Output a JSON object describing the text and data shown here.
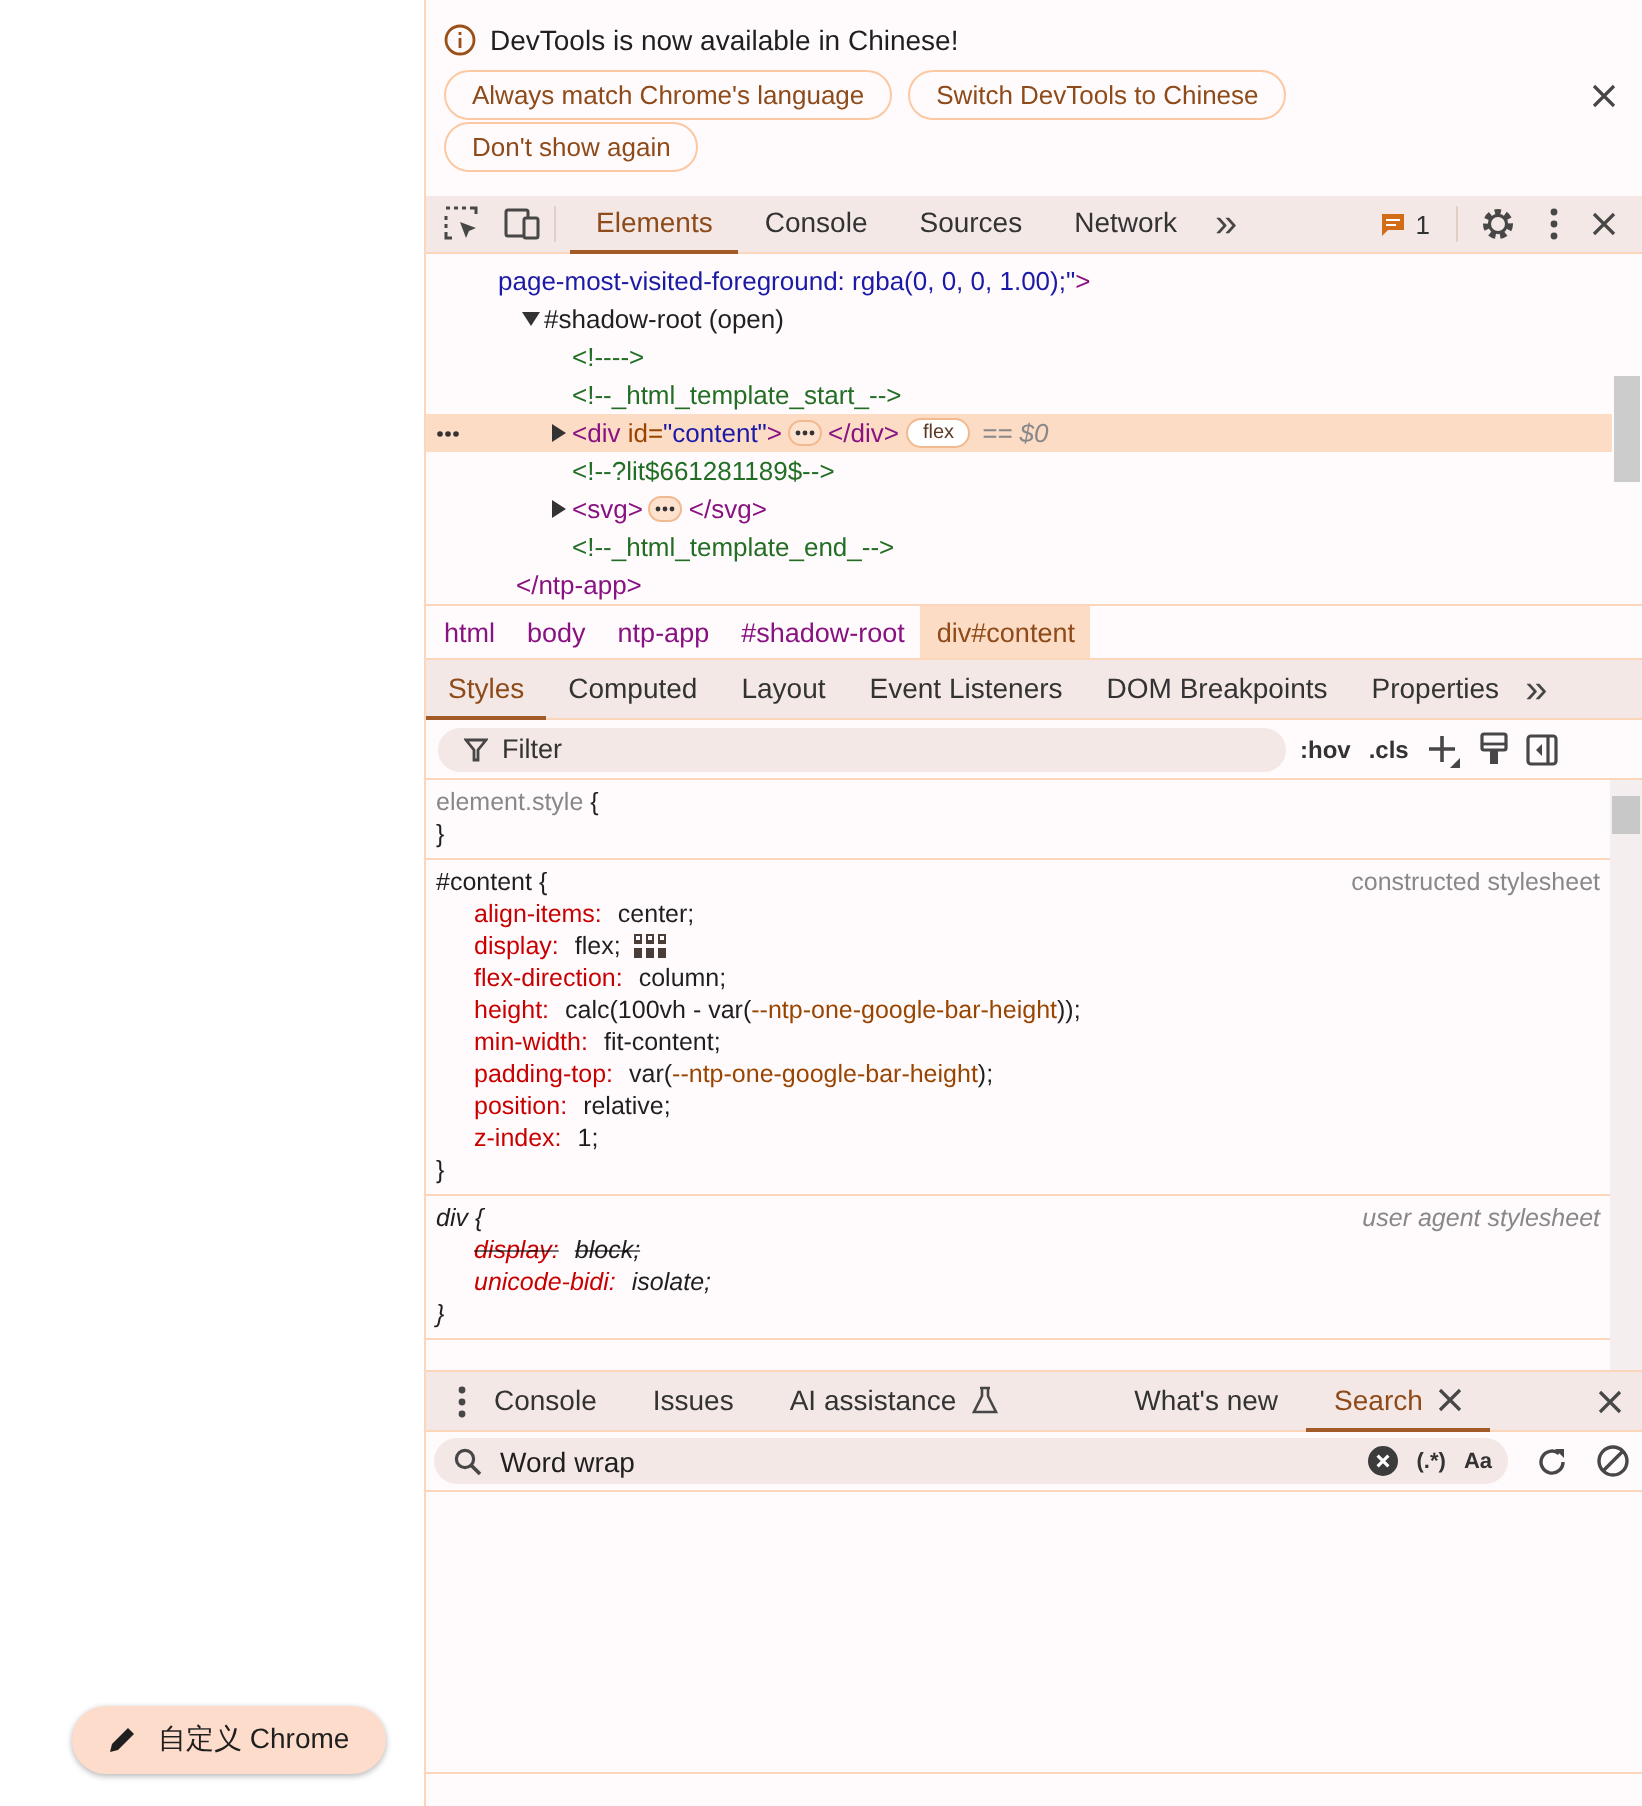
{
  "page": {
    "customize_button": "自定义 Chrome"
  },
  "infobar": {
    "message": "DevTools is now available in Chinese!",
    "buttons": [
      "Always match Chrome's language",
      "Switch DevTools to Chinese",
      "Don't show again"
    ]
  },
  "main_toolbar": {
    "tabs": [
      {
        "label": "Elements",
        "selected": true
      },
      {
        "label": "Console",
        "selected": false
      },
      {
        "label": "Sources",
        "selected": false
      },
      {
        "label": "Network",
        "selected": false
      }
    ],
    "overflow": "»",
    "issues_count": "1"
  },
  "dom_tree": {
    "nodes": [
      {
        "kind": "element-tail",
        "tail": [
          {
            "text": "page-most-visited-foreground: rgba(0, 0, 0, 1.00);\"",
            "kind": "attr-value"
          },
          {
            "text": ">",
            "kind": "tag"
          }
        ],
        "close": [
          {
            "text": "</ntp-app>",
            "kind": "tag"
          }
        ],
        "children": [
          {
            "kind": "shadow-root",
            "label": "#shadow-root (open)",
            "expanded": true,
            "children": [
              {
                "kind": "comment",
                "text": "<!---->"
              },
              {
                "kind": "comment",
                "text": "<!--_html_template_start_-->"
              },
              {
                "kind": "element",
                "open": [
                  {
                    "text": "<div ",
                    "kind": "tag"
                  },
                  {
                    "text": "id=",
                    "kind": "attr-name"
                  },
                  {
                    "text": "\"content\"",
                    "kind": "attr-value"
                  },
                  {
                    "text": ">",
                    "kind": "tag"
                  }
                ],
                "close": [
                  {
                    "text": "</div>",
                    "kind": "tag"
                  }
                ],
                "badge": "flex",
                "hint": "== $0",
                "expanded": false,
                "selected": true
              },
              {
                "kind": "comment",
                "text": "<!--?lit$661281189$-->"
              },
              {
                "kind": "element",
                "open": [
                  {
                    "text": "<svg>",
                    "kind": "tag"
                  }
                ],
                "close": [
                  {
                    "text": "</svg>",
                    "kind": "tag"
                  }
                ],
                "expanded": false,
                "selected": false
              },
              {
                "kind": "comment",
                "text": "<!--_html_template_end_-->"
              }
            ]
          }
        ]
      }
    ]
  },
  "breadcrumbs": [
    {
      "label": "html",
      "selected": false
    },
    {
      "label": "body",
      "selected": false
    },
    {
      "label": "ntp-app",
      "selected": false
    },
    {
      "label": "#shadow-root",
      "selected": false
    },
    {
      "label": "div#content",
      "selected": true
    }
  ],
  "styles": {
    "tabs": [
      {
        "label": "Styles",
        "selected": true
      },
      {
        "label": "Computed",
        "selected": false
      },
      {
        "label": "Layout",
        "selected": false
      },
      {
        "label": "Event Listeners",
        "selected": false
      },
      {
        "label": "DOM Breakpoints",
        "selected": false
      },
      {
        "label": "Properties",
        "selected": false
      }
    ],
    "overflow": "»",
    "filter": {
      "placeholder": "Filter"
    },
    "hov": ":hov",
    "cls": ".cls",
    "rules": [
      {
        "kind": "inline",
        "selector": "element.style",
        "open_brace": "{",
        "close_brace": "}"
      },
      {
        "kind": "author",
        "selector": "#content",
        "open_brace": "{",
        "close_brace": "}",
        "source": "constructed stylesheet",
        "declarations": [
          {
            "name": "align-items:",
            "value": [
              {
                "text": "center;",
                "kind": "plain"
              }
            ],
            "overridden": false,
            "flex_editor": false
          },
          {
            "name": "display:",
            "value": [
              {
                "text": "flex;",
                "kind": "plain"
              }
            ],
            "overridden": false,
            "flex_editor": true
          },
          {
            "name": "flex-direction:",
            "value": [
              {
                "text": "column;",
                "kind": "plain"
              }
            ],
            "overridden": false,
            "flex_editor": false
          },
          {
            "name": "height:",
            "value": [
              {
                "text": "calc(100vh - var(",
                "kind": "plain"
              },
              {
                "text": "--ntp-one-google-bar-height",
                "kind": "var"
              },
              {
                "text": "));",
                "kind": "plain"
              }
            ],
            "overridden": false,
            "flex_editor": false
          },
          {
            "name": "min-width:",
            "value": [
              {
                "text": "fit-content;",
                "kind": "plain"
              }
            ],
            "overridden": false,
            "flex_editor": false
          },
          {
            "name": "padding-top:",
            "value": [
              {
                "text": "var(",
                "kind": "plain"
              },
              {
                "text": "--ntp-one-google-bar-height",
                "kind": "var"
              },
              {
                "text": ");",
                "kind": "plain"
              }
            ],
            "overridden": false,
            "flex_editor": false
          },
          {
            "name": "position:",
            "value": [
              {
                "text": "relative;",
                "kind": "plain"
              }
            ],
            "overridden": false,
            "flex_editor": false
          },
          {
            "name": "z-index:",
            "value": [
              {
                "text": "1;",
                "kind": "plain"
              }
            ],
            "overridden": false,
            "flex_editor": false
          }
        ]
      },
      {
        "kind": "user-agent",
        "selector": "div",
        "open_brace": "{",
        "close_brace": "}",
        "source": "user agent stylesheet",
        "declarations": [
          {
            "name": "display:",
            "value": [
              {
                "text": "block;",
                "kind": "plain"
              }
            ],
            "overridden": true,
            "flex_editor": false
          },
          {
            "name": "unicode-bidi:",
            "value": [
              {
                "text": "isolate;",
                "kind": "plain"
              }
            ],
            "overridden": false,
            "flex_editor": false
          }
        ]
      }
    ]
  },
  "drawer": {
    "tabs": [
      {
        "label": "Console",
        "selected": false,
        "closable": false,
        "experimental": false
      },
      {
        "label": "Issues",
        "selected": false,
        "closable": false,
        "experimental": false
      },
      {
        "label": "AI assistance",
        "selected": false,
        "closable": false,
        "experimental": true
      },
      {
        "label": "What's new",
        "selected": false,
        "closable": false,
        "experimental": false
      },
      {
        "label": "Search",
        "selected": true,
        "closable": true,
        "experimental": false
      }
    ],
    "search": {
      "value": "Word wrap",
      "regex": "(.*)",
      "match_case": "Aa"
    }
  }
}
